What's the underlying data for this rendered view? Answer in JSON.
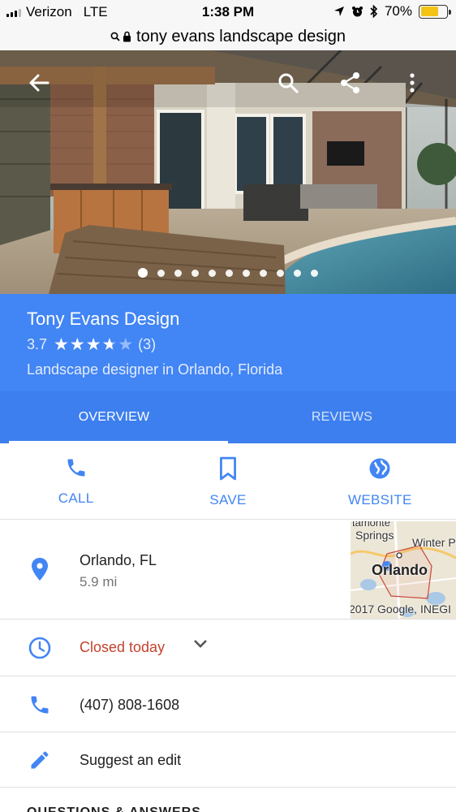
{
  "status_bar": {
    "carrier": "Verizon",
    "network": "LTE",
    "time": "1:38 PM",
    "battery_pct": "70%",
    "battery_level": 0.7
  },
  "url_bar": {
    "query": "tony evans landscape design"
  },
  "hero": {
    "photo_count": 11,
    "active_photo": 0,
    "icons": [
      "back-arrow-icon",
      "search-icon",
      "share-icon",
      "more-vert-icon"
    ]
  },
  "place": {
    "name": "Tony Evans Design",
    "rating": "3.7",
    "rating_value": 3.7,
    "review_count": "(3)",
    "category": "Landscape designer in Orlando, Florida"
  },
  "tabs": [
    {
      "label": "OVERVIEW",
      "active": true
    },
    {
      "label": "REVIEWS",
      "active": false
    }
  ],
  "actions": [
    {
      "label": "CALL",
      "icon": "phone-icon"
    },
    {
      "label": "SAVE",
      "icon": "bookmark-icon"
    },
    {
      "label": "WEBSITE",
      "icon": "globe-icon"
    }
  ],
  "address": {
    "line1": "Orlando, FL",
    "distance": "5.9 mi"
  },
  "map": {
    "label_springs": "Springs",
    "label_winter": "Winter P",
    "label_city": "Orlando",
    "label_top": "tamonte",
    "attribution": "2017 Google, INEGI"
  },
  "hours": {
    "status": "Closed today"
  },
  "phone": {
    "number": "(407) 808-1608"
  },
  "suggest_edit": {
    "label": "Suggest an edit"
  },
  "section": {
    "title": "QUESTIONS & ANSWERS"
  },
  "colors": {
    "brand_blue": "#4285f4",
    "tab_blue": "#3d7fee",
    "closed_red": "#c5432b",
    "star": "#ffffff"
  }
}
